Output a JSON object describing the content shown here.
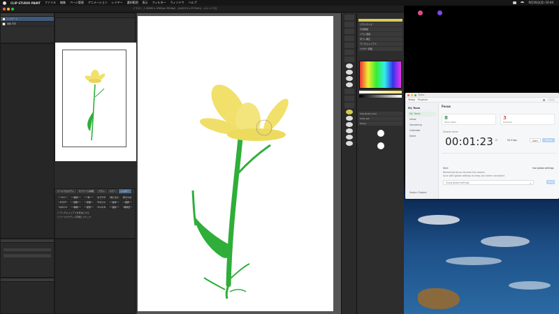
{
  "menubar": {
    "app_name": "CLIP STUDIO PAINT",
    "items": [
      "ファイル",
      "編集",
      "ページ管理",
      "アニメーション",
      "レイヤー",
      "選択範囲",
      "表示",
      "フィルター",
      "ウィンドウ",
      "ヘルプ"
    ],
    "clock": "9月16日(月) 10:44"
  },
  "canvas_app": {
    "doc_title": "イラスト_1 (8000 x 4500px 350dpi) - [A4(210 x 297mm) - キャンバス]",
    "layers": [
      {
        "label": "用紙 背景"
      },
      {
        "label": "レイヤー 1"
      }
    ],
    "property_tabs": [
      "ツールプロパティ",
      "サブツール詳細",
      "ブラシ",
      "カラー",
      "レイヤー"
    ],
    "brush_buttons": [
      "ペン",
      "鉛筆",
      "筆",
      "エアブラシ",
      "消しゴム",
      "塗りつぶし",
      "グラデ",
      "図形",
      "定規",
      "テキスト",
      "操作",
      "選択",
      "スポイト",
      "移動",
      "変形",
      "フィルタ",
      "連続",
      "線修正"
    ],
    "checkbox_labels": [
      "アンチエイリアスを有効にする",
      "パースペクティブ定規にスナップ"
    ],
    "right_rows": [
      "ブラシサイズ",
      "不透明度",
      "ブラシ濃度",
      "手ブレ補正",
      "アンチエイリアス",
      "ベクター吸着"
    ],
    "sub_tools": [
      "Clip studio color",
      "Color set",
      "Tones"
    ],
    "accent_colors": {
      "selection": "#4d6b8f",
      "flower_yellow": "#f1e06a",
      "stem_green": "#2fae3a"
    }
  },
  "timer_app": {
    "window_title": "Tasks",
    "toolbar": {
      "left": "Today",
      "right": "Projects"
    },
    "sidebar": {
      "heading": "My Team",
      "items": [
        "My Tasks",
        "Inbox",
        "Upcoming",
        "Calendar",
        "Done"
      ],
      "footer": "Switch Project"
    },
    "main": {
      "title": "Focus",
      "stats": [
        {
          "value": "8",
          "label": "Open tasks"
        },
        {
          "value": "3",
          "label": "Overdue"
        }
      ],
      "session_label": "Session timer",
      "timer_value": "00:01:23",
      "timer_inputs": [
        "5",
        "10"
      ],
      "speed_value": "54.3 kps",
      "button_start": "Start",
      "button_pause": "Pause",
      "notes_heading": "Note",
      "notes_lines": [
        "Remaining focus minutes this session",
        "Sync with global settings to keep your timer consistent"
      ],
      "toggle_label": "Use global settings",
      "select_value": "Using global settings",
      "apply_label": "Save"
    }
  }
}
